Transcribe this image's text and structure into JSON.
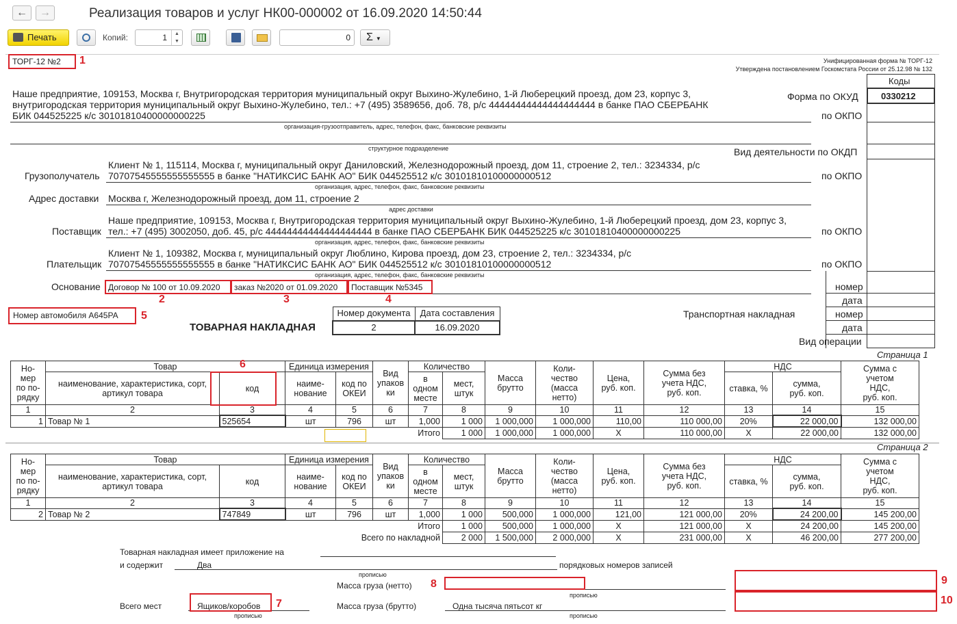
{
  "window": {
    "title": "Реализация товаров и услуг НК00-000002 от 16.09.2020 14:50:44"
  },
  "toolbar": {
    "back": "🡐",
    "forward": "🡒",
    "print_label": "Печать",
    "copies_label": "Копий:",
    "copies_value": "1",
    "counter_value": "0",
    "sum_label": "Σ"
  },
  "header": {
    "form_name": "ТОРГ-12 №2",
    "unified": "Унифицированная форма № ТОРГ-12",
    "approved": "Утверждена постановлением Госкомстата России от 25.12.98 № 132",
    "codes": "Коды",
    "okud_label": "Форма по ОКУД",
    "okud_value": "0330212",
    "okpo": "по ОКПО",
    "okdp": "Вид деятельности по ОКДП"
  },
  "shipper": {
    "line1": "Наше предприятие, 109153, Москва г, Внутригородская территория муниципальный округ Выхино-Жулебино, 1-й Люберецкий проезд, дом 23, корпус 3,",
    "line2": "внутригородская территория муниципальный округ Выхино-Жулебино, тел.: +7 (495) 3589656, доб. 78, р/с 44444444444444444444 в банке ПАО СБЕРБАНК",
    "line3": "БИК 044525225 к/с 30101810400000000225",
    "caption": "организация-грузоотправитель, адрес, телефон, факс, банковские реквизиты",
    "dept_caption": "структурное подразделение"
  },
  "consignee": {
    "label": "Грузополучатель",
    "line1": "Клиент № 1, 115114, Москва г, муниципальный округ Даниловский, Железнодорожный проезд, дом 11, строение 2, тел.: 3234334, р/с",
    "line2": "70707545555555555555 в банке \"НАТИКСИС БАНК АО\" БИК 044525512 к/с 30101810100000000512",
    "caption": "организация, адрес, телефон, факс, банковские реквизиты"
  },
  "delivery": {
    "label": "Адрес доставки",
    "value": "Москва г, Железнодорожный проезд, дом 11, строение 2",
    "caption": "адрес доставки"
  },
  "supplier": {
    "label": "Поставщик",
    "line1": "Наше предприятие, 109153, Москва г, Внутригородская территория муниципальный округ Выхино-Жулебино, 1-й Люберецкий проезд, дом 23, корпус 3,",
    "line2": "тел.: +7 (495) 3002050, доб. 45, р/с 44444444444444444444 в банке ПАО СБЕРБАНК БИК 044525225 к/с 30101810400000000225",
    "caption": "организация, адрес, телефон, факс, банковские реквизиты"
  },
  "payer": {
    "label": "Плательщик",
    "line1": "Клиент № 1, 109382, Москва г, муниципальный округ Люблино, Кирова проезд, дом 23, строение 2, тел.: 3234334, р/с",
    "line2": "70707545555555555555 в банке \"НАТИКСИС БАНК АО\" БИК 044525512 к/с 30101810100000000512",
    "caption": "организация, адрес, телефон, факс, банковские реквизиты"
  },
  "basis": {
    "label": "Основание",
    "contract": "Договор № 100 от 10.09.2020",
    "order": "заказ №2020 от 01.09.2020",
    "supplier_no": "Поставщик №5345"
  },
  "side": {
    "nomer": "номер",
    "data": "дата",
    "transport": "Транспортная накладная",
    "operation": "Вид операции"
  },
  "vehicle": "Номер автомобиля А645РА",
  "doc": {
    "title": "ТОВАРНАЯ НАКЛАДНАЯ",
    "num_label": "Номер документа",
    "date_label": "Дата составления",
    "num": "2",
    "date": "16.09.2020"
  },
  "annotations": [
    "1",
    "2",
    "3",
    "4",
    "5",
    "6",
    "7",
    "8",
    "9",
    "10"
  ],
  "table_head": {
    "no": "Но-\nмер\nпо по-\nрядку",
    "goods": "Товар",
    "goods_sub": "наименование, характеристика, сорт, артикул товара",
    "code": "код",
    "unit": "Единица измерения",
    "unit_name": "наиме-\nнование",
    "okei": "код по\nОКЕИ",
    "pack": "Вид\nупаков\nки",
    "qty": "Количество",
    "in_one": "в\nодном\nместе",
    "places": "мест,\nштук",
    "gross": "Масса\nбрутто",
    "net": "Коли-\nчество\n(масса\nнетто)",
    "price": "Цена,\nруб. коп.",
    "sum_no_vat": "Сумма без\nучета НДС,\nруб. коп.",
    "vat": "НДС",
    "rate": "ставка, %",
    "vat_sum": "сумма,\nруб. коп.",
    "total": "Сумма с\nучетом\nНДС,\nруб. коп.",
    "nums": [
      "1",
      "2",
      "3",
      "4",
      "5",
      "6",
      "7",
      "8",
      "9",
      "10",
      "11",
      "12",
      "13",
      "14",
      "15"
    ]
  },
  "page1": {
    "label": "Страница 1",
    "rows": [
      [
        "1",
        "Товар № 1",
        "525654",
        "шт",
        "796",
        "шт",
        "1,000",
        "1 000",
        "1 000,000",
        "1 000,000",
        "110,00",
        "110 000,00",
        "20%",
        "22 000,00",
        "132 000,00"
      ]
    ],
    "itogo": [
      "Итого",
      "1 000",
      "1 000,000",
      "1 000,000",
      "X",
      "110 000,00",
      "X",
      "22 000,00",
      "132 000,00"
    ]
  },
  "page2": {
    "label": "Страница 2",
    "rows": [
      [
        "2",
        "Товар № 2",
        "747849",
        "шт",
        "796",
        "шт",
        "1,000",
        "1 000",
        "500,000",
        "1 000,000",
        "121,00",
        "121 000,00",
        "20%",
        "24 200,00",
        "145 200,00"
      ]
    ],
    "itogo": [
      "Итого",
      "1 000",
      "500,000",
      "1 000,000",
      "X",
      "121 000,00",
      "X",
      "24 200,00",
      "145 200,00"
    ],
    "vsego": [
      "Всего по накладной",
      "2 000",
      "1 500,000",
      "2 000,000",
      "X",
      "231 000,00",
      "X",
      "46 200,00",
      "277 200,00"
    ]
  },
  "footer": {
    "appendix": "Товарная накладная имеет приложение на",
    "contains": "и содержит",
    "contains_value": "Два",
    "records": "порядковых номеров записей",
    "propisyu": "прописью",
    "net_label": "Масса груза (нетто)",
    "gross_label": "Масса груза (брутто)",
    "gross_value": "Одна тысяча пятьсот кг",
    "places_label": "Всего мест",
    "places_value": "Ящиков/коробов"
  }
}
